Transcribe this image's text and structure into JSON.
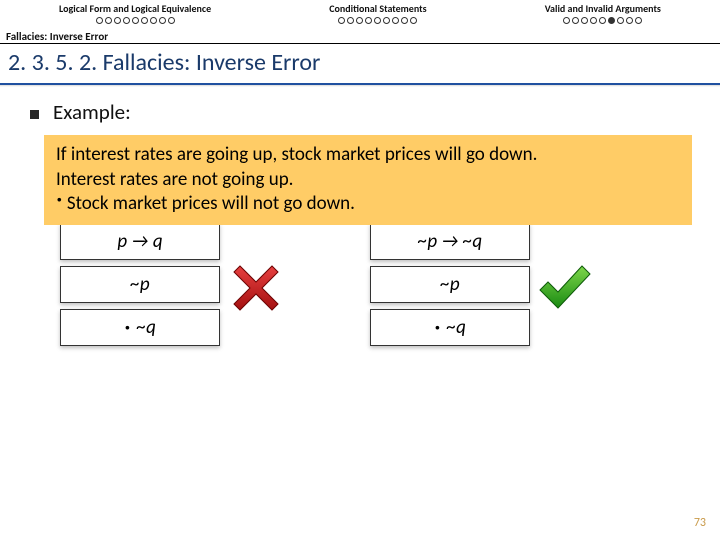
{
  "nav": {
    "c1": "Logical Form and Logical Equivalence",
    "c2": "Conditional Statements",
    "c3": "Valid and Invalid Arguments"
  },
  "breadcrumb": "Fallacies: Inverse Error",
  "title": "2. 3. 5. 2. Fallacies: Inverse Error",
  "example_label": "Example:",
  "box": {
    "l1": "If interest rates are going up, stock market prices will go down.",
    "l2": "Interest rates are not going up.",
    "l3_prefix": "·",
    "l3": " Stock market prices will not go down."
  },
  "left": {
    "r1": "p → q",
    "r2": "~p",
    "r3": "~q"
  },
  "right": {
    "r1": "~p → ~q",
    "r2": "~p",
    "r3": "~q"
  },
  "pagenum": "73"
}
